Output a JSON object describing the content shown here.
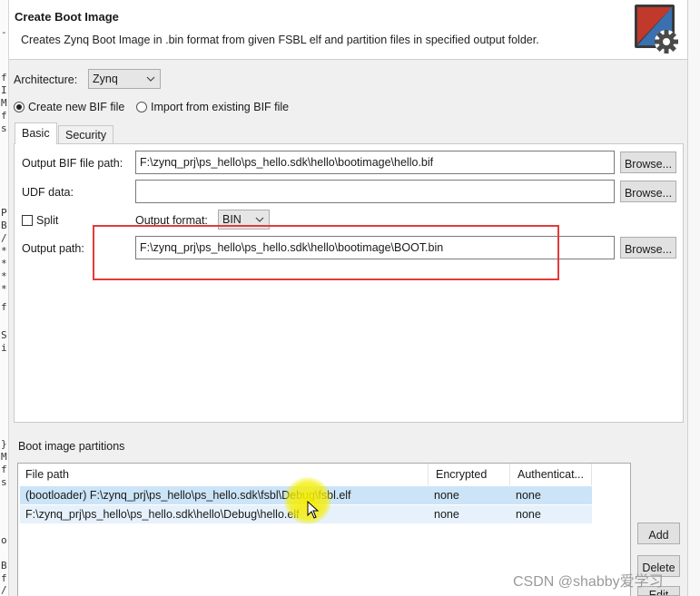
{
  "background": {
    "gutter_chars": [
      "-",
      "f",
      "I",
      "M",
      "f",
      "s",
      "P",
      "B",
      "/",
      "*",
      "*",
      "*",
      "*",
      "f",
      "S",
      "i",
      "}",
      "M",
      "f",
      "s",
      "o",
      "B",
      "f",
      "/"
    ]
  },
  "dialog": {
    "title": "Create Boot Image",
    "description": "Creates Zynq Boot Image in .bin format from given FSBL elf and partition files in specified output folder.",
    "logo_icon": "boot-image-gear-icon"
  },
  "architecture": {
    "label": "Architecture:",
    "value": "Zynq"
  },
  "mode": {
    "create_label": "Create new BIF file",
    "create_selected": true,
    "import_label": "Import from existing BIF file",
    "import_selected": false
  },
  "tabs": [
    {
      "label": "Basic",
      "active": true
    },
    {
      "label": "Security",
      "active": false
    }
  ],
  "basic": {
    "output_bif_label": "Output BIF file path:",
    "output_bif_value": "F:\\zynq_prj\\ps_hello\\ps_hello.sdk\\hello\\bootimage\\hello.bif",
    "udf_label": "UDF data:",
    "udf_value": "",
    "split_label": "Split",
    "split_checked": false,
    "output_format_label": "Output format:",
    "output_format_value": "BIN",
    "output_path_label": "Output path:",
    "output_path_value": "F:\\zynq_prj\\ps_hello\\ps_hello.sdk\\hello\\bootimage\\BOOT.bin",
    "browse_label": "Browse..."
  },
  "partitions": {
    "section_label": "Boot image partitions",
    "columns": [
      "File path",
      "Encrypted",
      "Authenticat..."
    ],
    "rows": [
      {
        "path": "(bootloader) F:\\zynq_prj\\ps_hello\\ps_hello.sdk\\fsbl\\Debug\\fsbl.elf",
        "encrypted": "none",
        "authentication": "none"
      },
      {
        "path": "F:\\zynq_prj\\ps_hello\\ps_hello.sdk\\hello\\Debug\\hello.elf",
        "encrypted": "none",
        "authentication": "none"
      }
    ],
    "add_label": "Add",
    "delete_label": "Delete",
    "edit_label": "Edit"
  },
  "watermark": "CSDN @shabby爱学习",
  "colors": {
    "highlight_box": "#e23b3b",
    "selected_row": "#cce4f7",
    "cursor_glow": "#f6ee00"
  }
}
